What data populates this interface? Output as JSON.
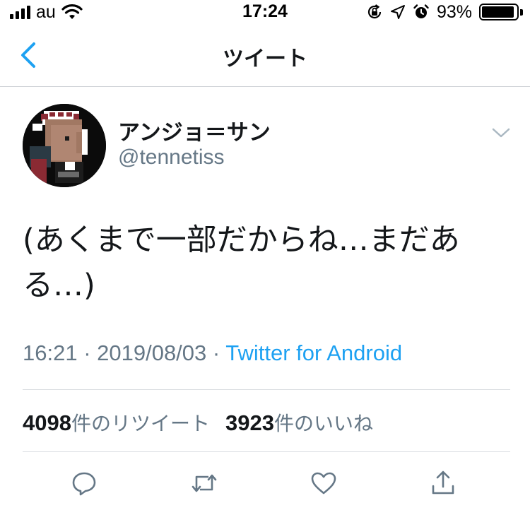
{
  "status_bar": {
    "carrier": "au",
    "time": "17:24",
    "battery_percent": "93%",
    "battery_level": 0.93,
    "icons": [
      "signal-bars-icon",
      "wifi-icon",
      "rotation-lock-icon",
      "location-arrow-icon",
      "alarm-icon",
      "battery-icon"
    ]
  },
  "nav": {
    "back_icon": "chevron-left-icon",
    "title": "ツイート"
  },
  "tweet": {
    "author_name": "アンジョ＝サン",
    "author_handle": "@tennetiss",
    "menu_icon": "chevron-down-icon",
    "text": "(あくまで一部だからね…まだある…)",
    "timestamp": "16:21 · 2019/08/03 · ",
    "source": "Twitter for Android"
  },
  "stats": {
    "retweets_count": "4098",
    "retweets_label": "件のリツイート",
    "likes_count": "3923",
    "likes_label": "件のいいね"
  },
  "actions": {
    "reply_icon": "reply-icon",
    "retweet_icon": "retweet-icon",
    "like_icon": "heart-icon",
    "share_icon": "share-icon"
  },
  "colors": {
    "accent": "#1da1f2",
    "secondary_text": "#657786",
    "primary_text": "#14171a",
    "icon_gray": "#657786"
  }
}
